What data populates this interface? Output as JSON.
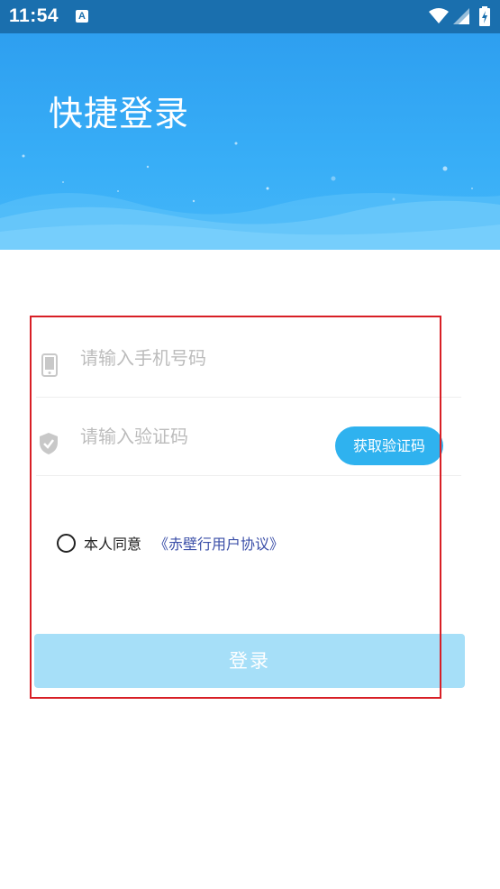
{
  "status_bar": {
    "time": "11:54",
    "notification_icon_letter": "A"
  },
  "header": {
    "title": "快捷登录",
    "background_color": "#38aef7"
  },
  "phone_field": {
    "placeholder": "请输入手机号码",
    "icon": "phone-icon"
  },
  "code_field": {
    "placeholder": "请输入验证码",
    "icon": "shield-check-icon"
  },
  "get_code_button": {
    "label": "获取验证码",
    "color": "#2fb2ef"
  },
  "agreement": {
    "label": "本人同意",
    "link_text": "《赤壁行用户协议》",
    "checked": false
  },
  "login_button": {
    "label": "登录",
    "color": "#a6dff8",
    "enabled": false
  },
  "highlight_color": "#d81f26"
}
